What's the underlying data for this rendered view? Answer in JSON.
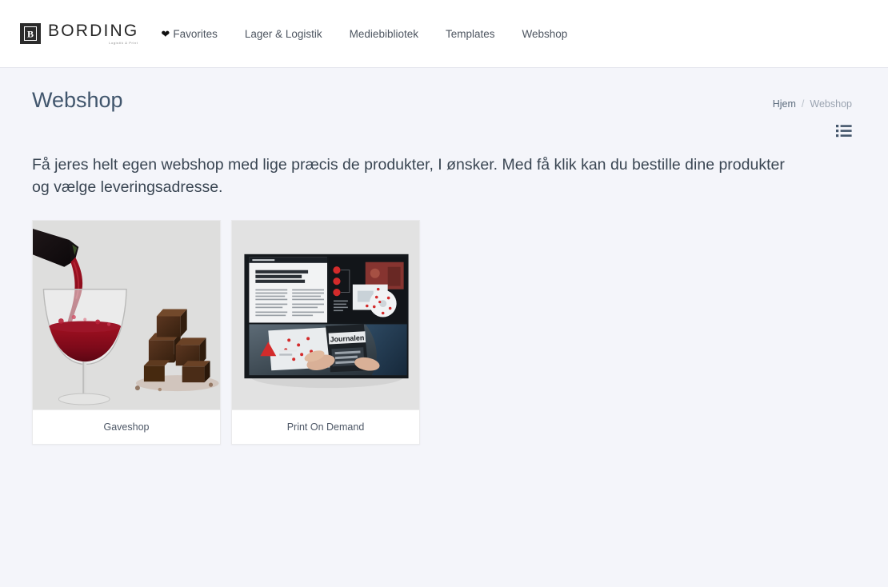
{
  "header": {
    "logo": {
      "mark_icon": "bording-b-monogram-icon",
      "word": "BORDING",
      "tagline": "Logistik & Print"
    },
    "nav": [
      {
        "id": "favorites",
        "label": "Favorites",
        "icon": "heart-icon"
      },
      {
        "id": "lager-logistik",
        "label": "Lager & Logistik",
        "icon": null
      },
      {
        "id": "mediebibliotek",
        "label": "Mediebibliotek",
        "icon": null
      },
      {
        "id": "templates",
        "label": "Templates",
        "icon": null
      },
      {
        "id": "webshop",
        "label": "Webshop",
        "icon": null
      }
    ]
  },
  "page": {
    "title": "Webshop",
    "breadcrumb": {
      "home": "Hjem",
      "separator": "/",
      "current": "Webshop"
    },
    "toolbar": {
      "list_view_icon": "list-view-icon"
    },
    "intro": "Få jeres helt egen webshop med lige præcis de produkter, I ønsker. Med få klik kan du bestille dine produkter og vælge leveringsadresse.",
    "cards": [
      {
        "id": "gaveshop",
        "label": "Gaveshop",
        "image": "red-wine-pouring-into-glass-with-chocolate-photo"
      },
      {
        "id": "print-on-demand",
        "label": "Print On Demand",
        "image": "open-magazine-spread-photo"
      }
    ]
  },
  "colors": {
    "page_background": "#f4f5fa",
    "header_background": "#ffffff",
    "title_text": "#41566d",
    "body_text": "#3a4653",
    "nav_text": "#4d5560",
    "breadcrumb_muted": "#9aa3b0",
    "card_background": "#ffffff",
    "logo_mark": "#2b2b2b"
  }
}
